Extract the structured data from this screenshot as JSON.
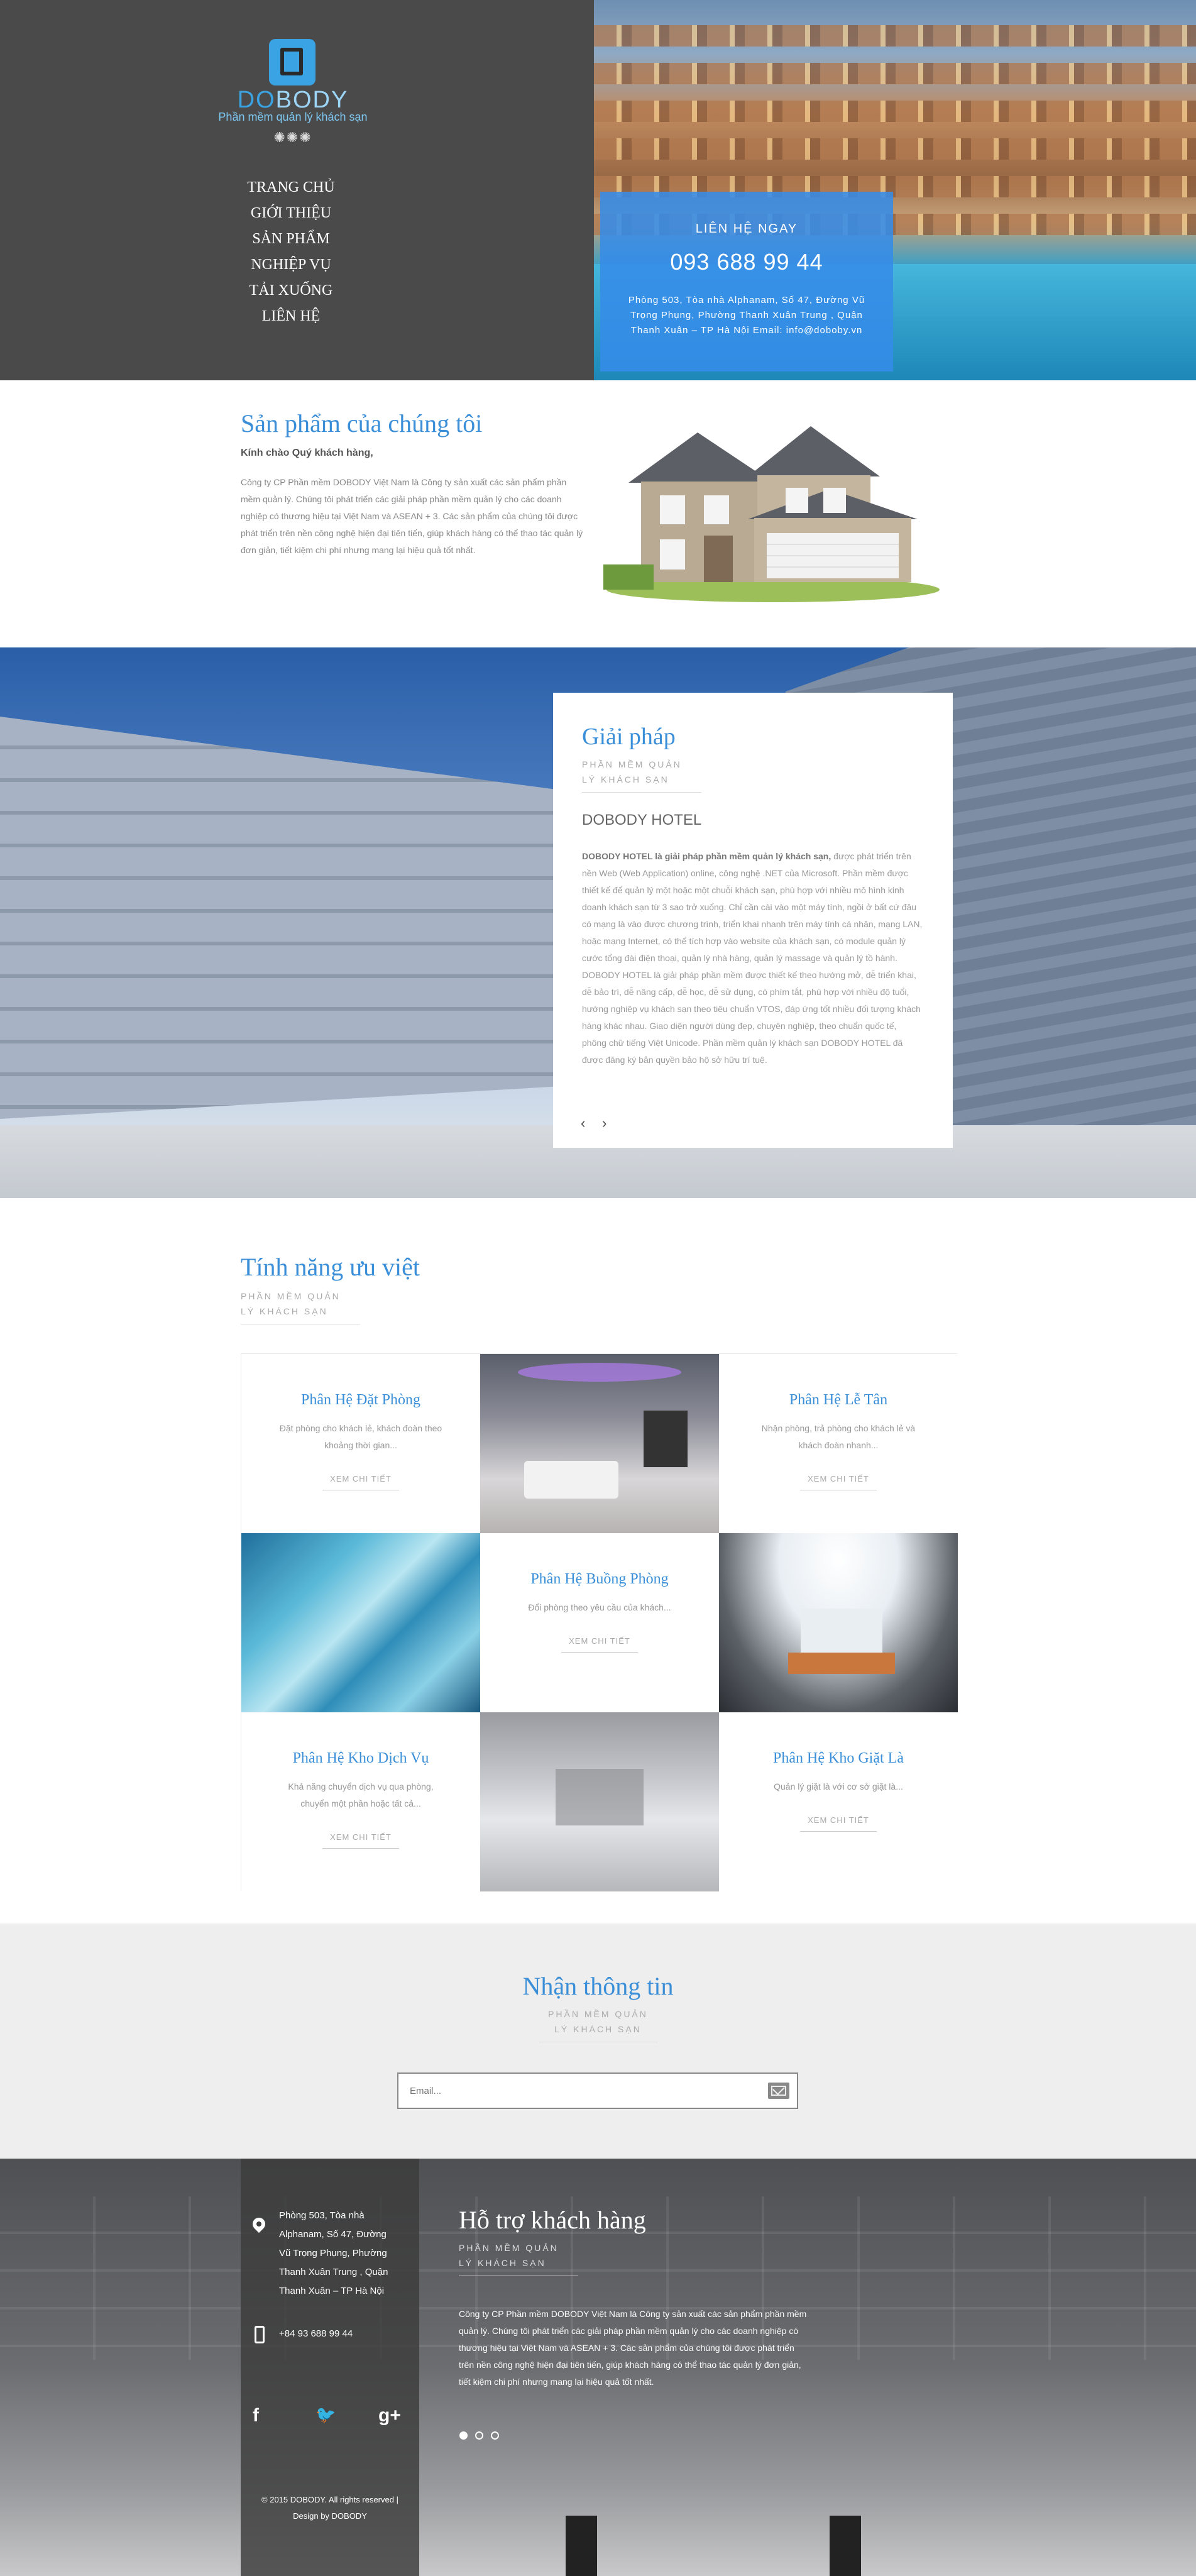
{
  "brand": {
    "logo_do": "DO",
    "logo_body": "BODY",
    "tagline": "Phần mềm quản lý khách sạn",
    "ornament": "✺✺✺"
  },
  "nav": [
    "TRANG CHỦ",
    "GIỚI THIỆU",
    "SẢN PHẨM",
    "NGHIỆP VỤ",
    "TẢI XUỐNG",
    "LIÊN HỆ"
  ],
  "contact": {
    "title": "LIÊN HỆ NGAY",
    "phone": "093 688 99 44",
    "address": "Phòng 503, Tòa nhà Alphanam, Số 47, Đường Vũ Trọng Phụng, Phường Thanh Xuân Trung , Quận Thanh Xuân – TP Hà Nội Email: info@doboby.vn"
  },
  "products": {
    "title": "Sản phẩm của chúng tôi",
    "greeting": "Kính chào Quý khách hàng,",
    "description": "Công ty CP Phần mềm DOBODY Việt Nam là Công ty sản xuất các sản phẩm phần mềm quản lý. Chúng tôi phát triển các giải pháp phần mềm quản lý cho các doanh nghiệp có thương hiệu tại Việt Nam và ASEAN + 3. Các sản phẩm của chúng tôi được phát triển trên nền công nghệ hiện đại tiên tiến, giúp khách hàng có thể thao tác quản lý đơn giản, tiết kiệm chi phí nhưng mang lại hiệu quả tốt nhất."
  },
  "solution": {
    "title": "Giải pháp",
    "sub_line1": "PHẦN MỀM QUẢN",
    "sub_line2": "LÝ KHÁCH SẠN",
    "product_name": "DOBODY HOTEL",
    "lead_bold": "DOBODY HOTEL là giải pháp phần mềm quản lý khách sạn,",
    "text": " được phát triển trên nền Web (Web Application) online, công nghệ .NET của Microsoft. Phần mềm được thiết kế để quản lý một hoặc một chuỗi khách sạn, phù hợp với nhiều mô hình kinh doanh khách sạn từ 3 sao trở xuống. Chỉ cần cài vào một máy tính, ngồi ở bất cứ đâu có mạng là vào được chương trình, triển khai nhanh trên máy tính cá nhân, mạng LAN, hoặc mạng Internet, có thể tích hợp vào website của khách sạn, có module quản lý cước tổng đài điện thoại, quản lý nhà hàng, quản lý massage và quản lý tồ hành. DOBODY HOTEL là giải pháp phần mềm được thiết kế theo hướng mở, dễ triển khai, dễ bảo trì, dễ nâng cấp, dễ học, dễ sử dụng, có phím tắt, phù hợp với nhiều độ tuổi, hướng nghiệp vụ khách sạn theo tiêu chuẩn VTOS, đáp ứng tốt nhiều đối tượng khách hàng khác nhau. Giao diện người dùng đẹp, chuyên nghiệp, theo chuẩn quốc tế, phông chữ tiếng Việt Unicode. Phần mềm quản lý khách sạn DOBODY HOTEL đã được đăng ký bản quyền bảo hộ sở hữu trí tuệ.",
    "prev": "‹",
    "next": "›"
  },
  "features": {
    "title": "Tính năng ưu việt",
    "sub_line1": "PHẦN MỀM QUẢN",
    "sub_line2": "LÝ KHÁCH SẠN",
    "button_label": "XEM CHI TIẾT",
    "items": [
      {
        "title": "Phân Hệ Đặt Phòng",
        "desc": "Đặt phòng cho khách lẻ, khách đoàn theo khoảng thời gian..."
      },
      {
        "title": "Phân Hệ Lễ Tân",
        "desc": "Nhận phòng, trả phòng cho khách lẻ và khách đoàn nhanh..."
      },
      {
        "title": "Phân Hệ Buồng Phòng",
        "desc": "Đổi phòng theo yêu cầu của khách..."
      },
      {
        "title": "Phân Hệ Kho Dịch Vụ",
        "desc": "Khả năng chuyển dịch vụ qua phòng, chuyển một phần hoặc tất cả..."
      },
      {
        "title": "Phân Hệ Kho Giặt Là",
        "desc": "Quản lý giặt là với cơ sở giặt là..."
      }
    ]
  },
  "newsletter": {
    "title": "Nhận thông tin",
    "sub_line1": "PHẦN MỀM QUẢN",
    "sub_line2": "LÝ KHÁCH SẠN",
    "placeholder": "Email..."
  },
  "footer": {
    "address_lines": [
      "Phòng 503, Tòa nhà",
      "Alphanam, Số 47, Đường",
      "Vũ Trọng Phụng, Phường",
      "Thanh Xuân Trung , Quận",
      "Thanh Xuân – TP Hà Nội"
    ],
    "phone": "+84 93 688 99 44",
    "copyright_line1": "© 2015 DOBODY. All rights reserved |",
    "copyright_line2": "Design by DOBODY",
    "support_title": "Hỗ trợ khách hàng",
    "sub_line1": "PHẦN MỀM QUẢN",
    "sub_line2": "LÝ KHÁCH SẠN",
    "support_text": "Công ty CP Phần mềm DOBODY Việt Nam là Công ty sản xuất các sản phẩm phần mềm quản lý. Chúng tôi phát triển các giải pháp phần mềm quản lý cho các doanh nghiệp có thương hiệu tại Việt Nam và ASEAN + 3. Các sản phẩm của chúng tôi được phát triển trên nền công nghệ hiện đại tiên tiến, giúp khách hàng có thể thao tác quản lý đơn giản, tiết kiệm chi phí nhưng mang lại hiệu quả tốt nhất.",
    "social": {
      "facebook": "f",
      "twitter": "🐦",
      "googleplus": "g+"
    }
  },
  "colors": {
    "accent": "#3a8fd8",
    "contact_box": "#368ce8",
    "hero_dark": "#4a4a4a"
  }
}
